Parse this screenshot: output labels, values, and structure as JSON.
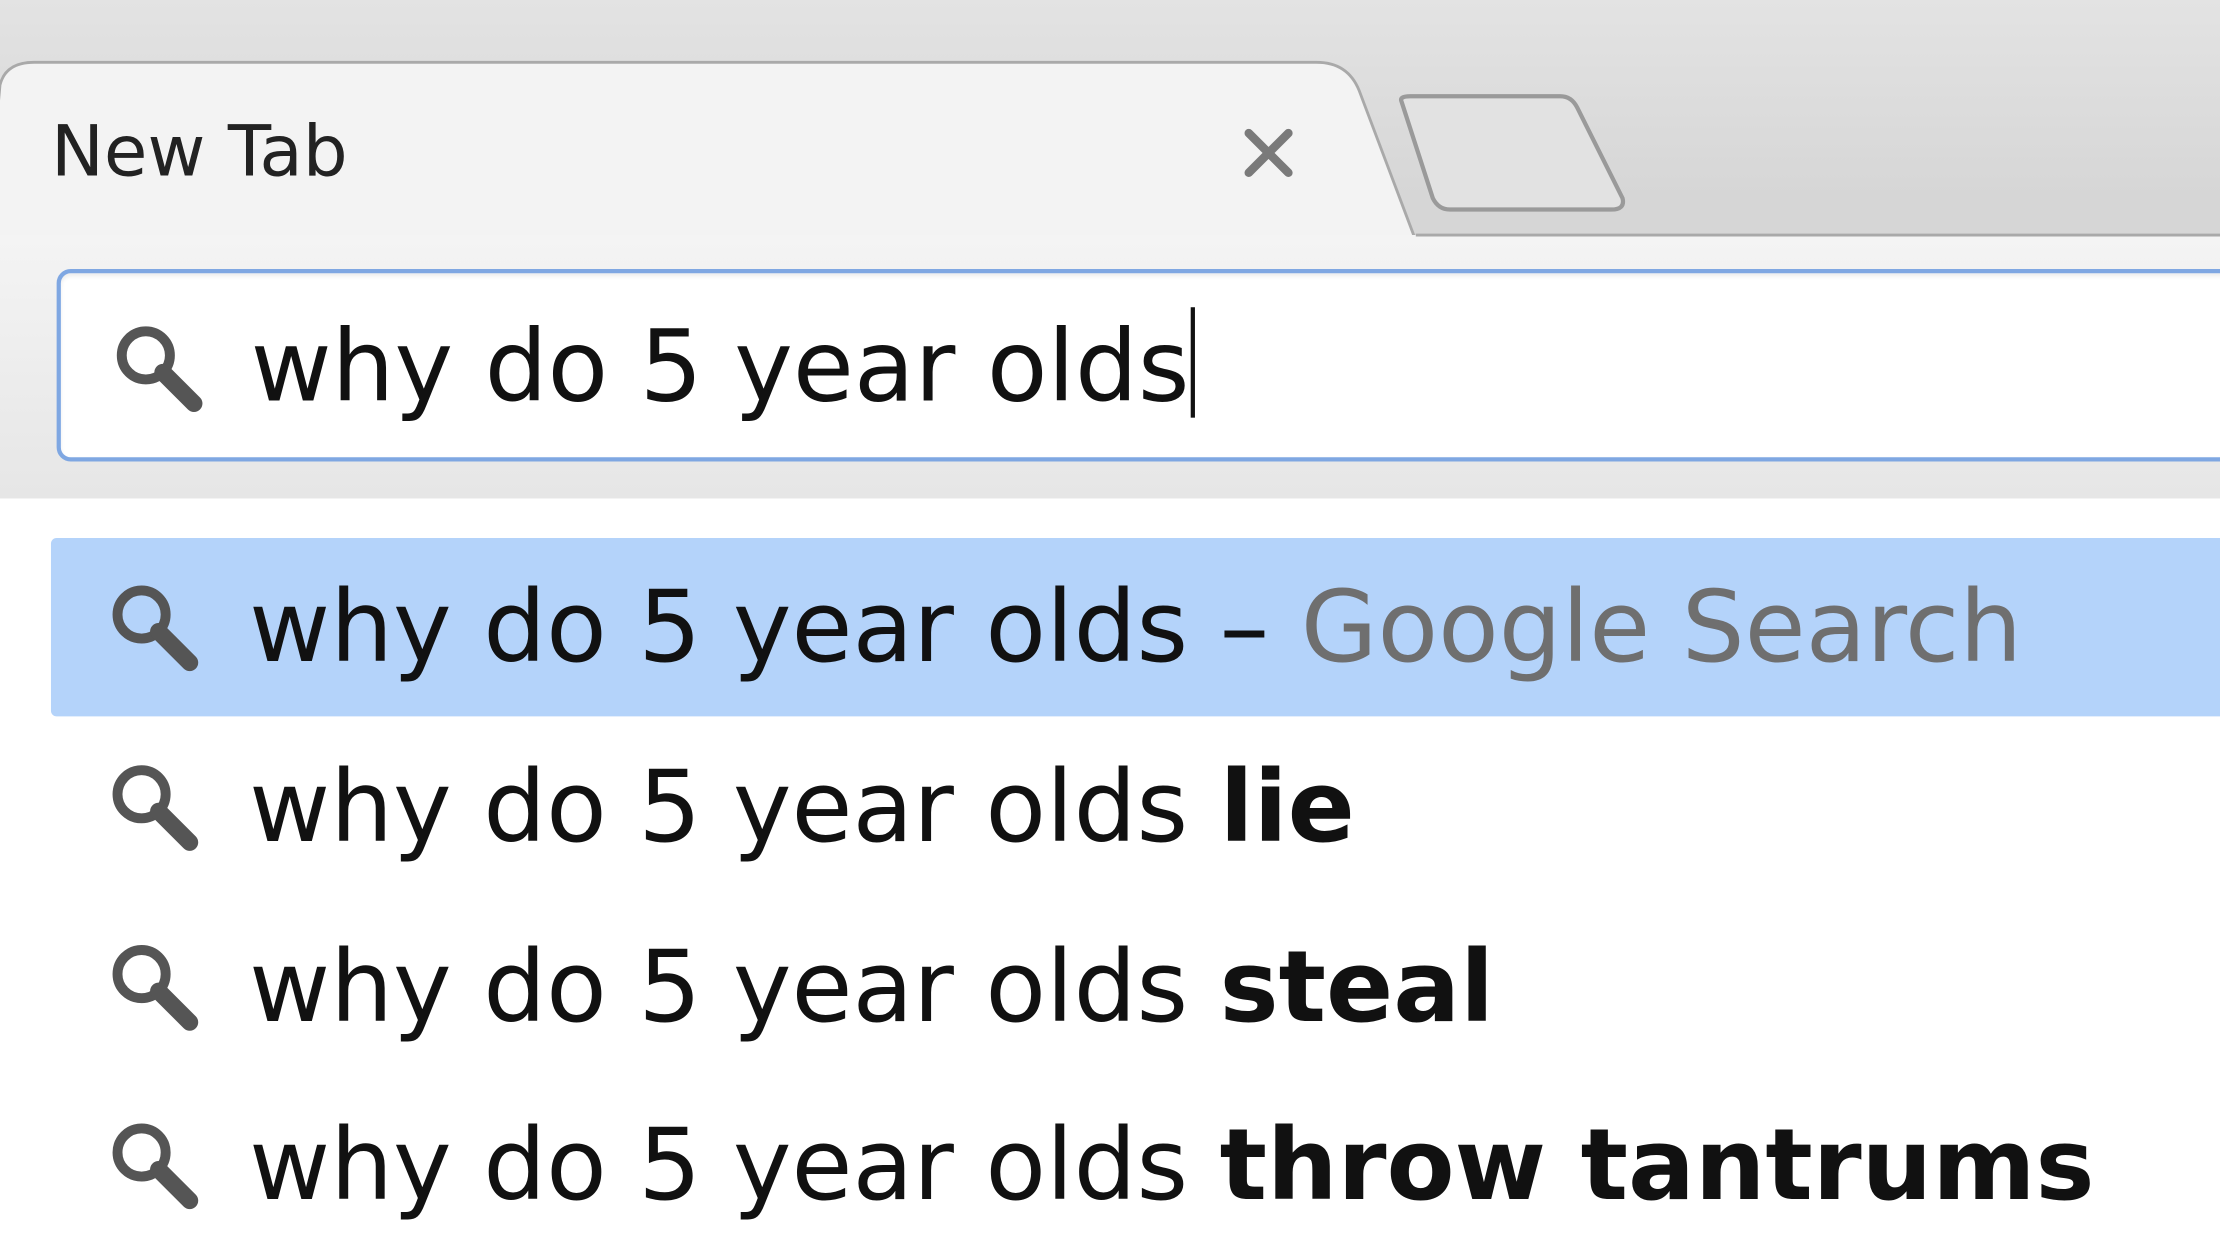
{
  "browser": {
    "tab": {
      "title": "New Tab",
      "close_icon": "close-icon"
    },
    "new_tab_button_icon": "new-tab-icon",
    "omnibox": {
      "icon": "search-icon",
      "value": "why do 5 year olds"
    }
  },
  "suggestions": {
    "selected_color": "#b4d3fa",
    "items": [
      {
        "icon": "search-icon",
        "query": "why do 5 year olds",
        "separator": " – ",
        "engine": "Google Search",
        "selected": true
      },
      {
        "icon": "search-icon",
        "query": "why do 5 year olds ",
        "completion": "lie",
        "selected": false
      },
      {
        "icon": "search-icon",
        "query": "why do 5 year olds ",
        "completion": "steal",
        "selected": false
      },
      {
        "icon": "search-icon",
        "query": "why do 5 year olds ",
        "completion": "throw tantrums",
        "selected": false
      }
    ]
  }
}
